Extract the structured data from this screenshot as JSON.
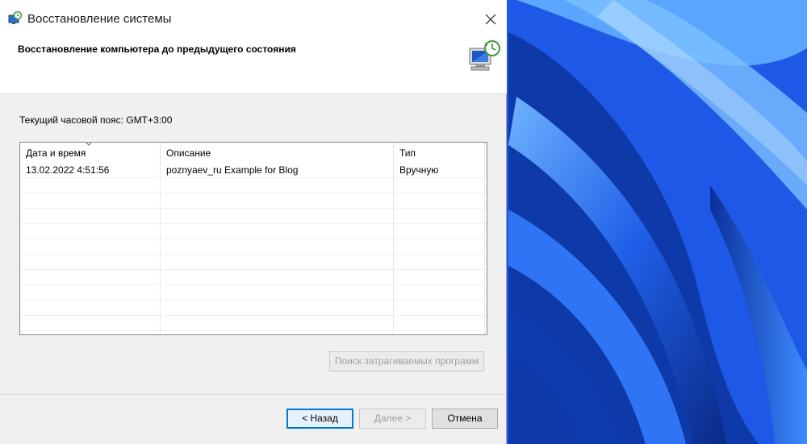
{
  "window": {
    "title": "Восстановление системы",
    "close_glyph": "✕",
    "header_title": "Восстановление компьютера до предыдущего состояния"
  },
  "timezone_label": "Текущий часовой пояс: GMT+3:00",
  "restore_list": {
    "columns": [
      "Дата и время",
      "Описание",
      "Тип"
    ],
    "sort_column": "Дата и время",
    "rows": [
      {
        "date": "13.02.2022 4:51:56",
        "description": "poznyaev_ru Example for Blog",
        "type": "Вручную"
      }
    ]
  },
  "buttons": {
    "scan": "Поиск затрагиваемых программ",
    "back": "< Назад",
    "next": "Далее >",
    "cancel": "Отмена"
  },
  "icons": {
    "title": "system-restore-icon",
    "header": "computer-restore-icon",
    "close": "close-icon",
    "sort": "sort-arrow-icon"
  },
  "colors": {
    "accent": "#0078d7",
    "wallpaper_dark": "#0a2f8f",
    "wallpaper_light": "#2a6cf0"
  }
}
